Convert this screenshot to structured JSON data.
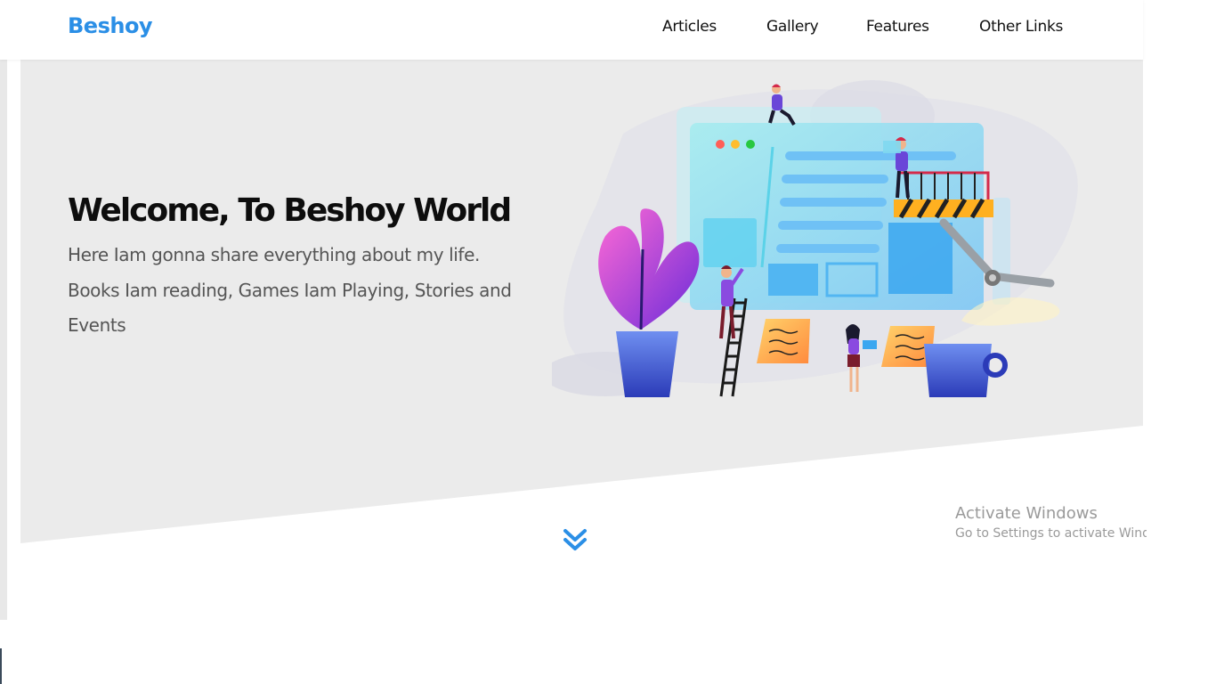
{
  "navbar": {
    "brand": "Beshoy",
    "links": [
      {
        "label": "Articles"
      },
      {
        "label": "Gallery"
      },
      {
        "label": "Features"
      },
      {
        "label": "Other Links"
      }
    ]
  },
  "hero": {
    "title": "Welcome, To Beshoy World",
    "text": "Here Iam gonna share everything about my life. Books Iam reading, Games Iam Playing, Stories and Events"
  },
  "scroll": {
    "icon": "double-chevron-down-icon"
  },
  "watermark": {
    "title": "Activate Windows",
    "subtitle": "Go to Settings to activate Windows."
  },
  "colors": {
    "brand": "#2b8fe6",
    "hero_bg": "#ebebeb",
    "title": "#0d0d0d",
    "text": "#555555",
    "chevron": "#2b8fe6"
  }
}
